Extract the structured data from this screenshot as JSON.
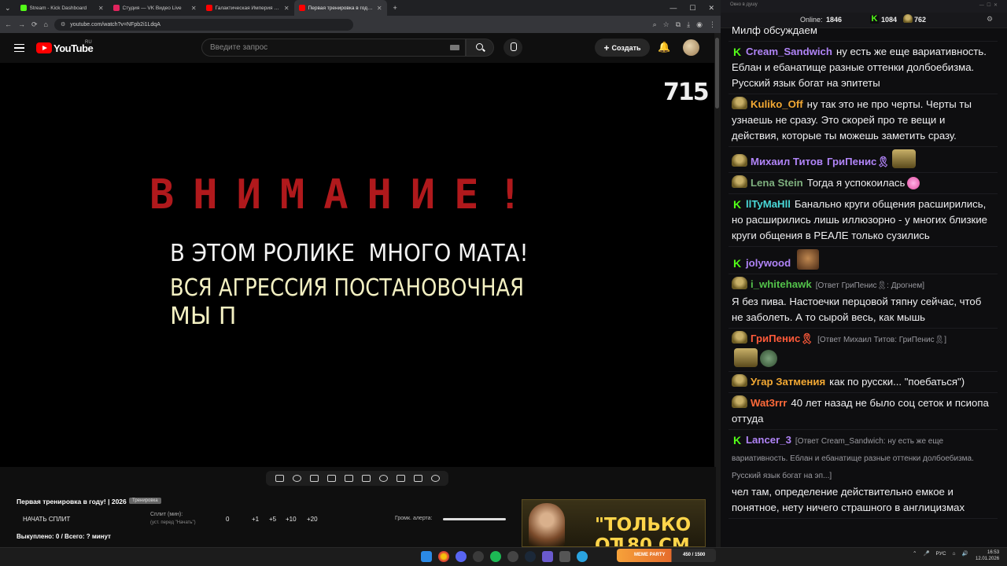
{
  "browser": {
    "tabs": [
      {
        "title": "Stream - Kick Dashboard",
        "color": "#53fc18"
      },
      {
        "title": "Студия — VK Видео Live",
        "color": "#e0245e"
      },
      {
        "title": "Галактическая Империя – воз",
        "color": "#ff0000"
      },
      {
        "title": "Первая тренировка в году! | 2",
        "color": "#ff0000"
      }
    ],
    "url": "youtube.com/watch?v=NFpb2i1LdqA"
  },
  "youtube": {
    "logo": "YouTube",
    "country": "RU",
    "search_placeholder": "Введите запрос",
    "create_label": "Создать"
  },
  "video": {
    "corner_number": "715",
    "warning": "ВНИМАНИЕ!",
    "line1": "В ЭТОМ РОЛИКЕ  МНОГО МАТА!",
    "line2": "ВСЯ АГРЕССИЯ ПОСТАНОВОЧНАЯ",
    "line3": "МЫ П"
  },
  "controls": {
    "title": "Первая тренировка в году! | 2026",
    "tag": "Тренировка",
    "start_split": "НАЧАТЬ СПЛИТ",
    "split_label": "Сплит (мин):",
    "split_hint": "(уст. перед \"Начать\")",
    "split_values": [
      "0",
      "+1",
      "+5",
      "+10",
      "+20"
    ],
    "volume_label": "Громк. алерта:",
    "volume_level": 0.95,
    "bought": "Выкуплено: 0 / Всего: ? минут",
    "promo_line1": "\"ТОЛЬКО ОТ",
    "promo_line2": "180 СМ \""
  },
  "chat": {
    "window_title": "Окно в душу",
    "online_label": "Online:",
    "online_value": "1846",
    "kick_count": "1084",
    "other_count": "762",
    "messages": [
      {
        "user": "",
        "text": "Милф обсуждаем",
        "color": "#efeff1",
        "badge": "none"
      },
      {
        "user": "Cream_Sandwich",
        "text": "ну есть же еще вариативность. Еблан и ебанатище разные оттенки долбоебизма. Русский язык богат на эпитеты",
        "color": "#b084f7",
        "badge": "kick"
      },
      {
        "user": "Kuliko_Off",
        "text": "ну так это не про черты. Черты ты узнаешь не сразу. Это скорей про те вещи и действия, которые ты можешь заметить сразу.",
        "color": "#f2a833",
        "badge": "face"
      },
      {
        "user": "Михаил Титов",
        "text": "ГриПенис🎗",
        "color": "#b084f7",
        "badge": "face",
        "emote": "glyph"
      },
      {
        "user": "Lena Stein",
        "text": "Тогда я успокоилась",
        "color": "#7fb07f",
        "badge": "face",
        "emote": "sm"
      },
      {
        "user": "llTyMaHll",
        "text": "Банально круги общения расширились, но расширились лишь иллюзорно - у многих близкие круги общения в РЕАЛЕ только сузились",
        "color": "#4ad9d9",
        "badge": "kick"
      },
      {
        "user": "jolywood",
        "text": "",
        "color": "#b084f7",
        "badge": "kick",
        "emote": "face"
      },
      {
        "user": "i_whitehawk",
        "reply": "[Ответ ГриПенис🎗: Дрогнем]",
        "text": "Я без пива. Настоечки перцовой тяпну сейчас, чтоб не заболеть. А то сырой весь, как мышь",
        "color": "#53c24a",
        "badge": "face"
      },
      {
        "user": "ГриПенис🎗",
        "reply": "[Ответ Михаил Титов: ГриПенис🎗]",
        "text": "",
        "color": "#ff5a3a",
        "badge": "face",
        "emote": "glyph"
      },
      {
        "user": "Угар Затмения",
        "text": "как по русски... \"поебаться\")",
        "color": "#f2a833",
        "badge": "face"
      },
      {
        "user": "Wat3rrr",
        "text": "40 лет назад не было соц сеток и псиопа оттуда",
        "color": "#ff6a3a",
        "badge": "face"
      },
      {
        "user": "Lancer_3",
        "reply": "[Ответ Cream_Sandwich: ну есть же еще вариативность. Еблан и ебанатище разные оттенки долбоебизма. Русский язык богат на эп...]",
        "text": "чел там, определение действительно емкое и понятное, нету ничего страшного в англицизмах",
        "color": "#b084f7",
        "badge": "kick"
      }
    ]
  },
  "taskbar": {
    "meme_label": "MEME PARTY",
    "meme_count": "450 / 1500",
    "lang": "РУС",
    "time": "16:53",
    "date": "12.01.2026"
  }
}
